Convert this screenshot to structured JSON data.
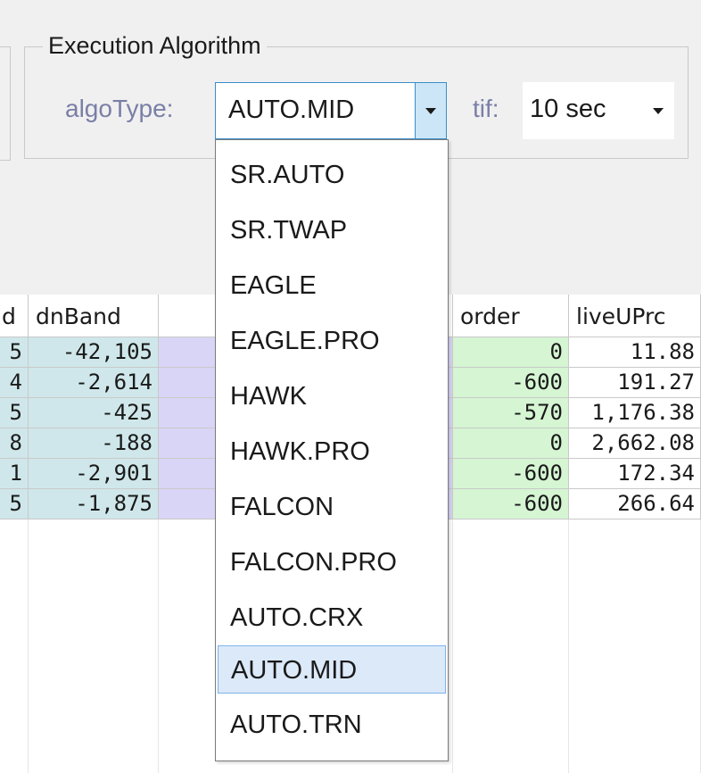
{
  "group": {
    "title": "Execution Algorithm",
    "algo_label": "algoType:",
    "algo_value": "AUTO.MID",
    "tif_label": "tif:",
    "tif_value": "10 sec"
  },
  "grid": {
    "headers": [
      "d",
      "dnBand",
      "",
      "order",
      "liveUPrc"
    ],
    "rows": [
      [
        "5",
        "-42,105",
        "",
        "0",
        "11.88"
      ],
      [
        "4",
        "-2,614",
        "",
        "-600",
        "191.27"
      ],
      [
        "5",
        "-425",
        "",
        "-570",
        "1,176.38"
      ],
      [
        "8",
        "-188",
        "",
        "0",
        "2,662.08"
      ],
      [
        "1",
        "-2,901",
        "",
        "-600",
        "172.34"
      ],
      [
        "5",
        "-1,875",
        "",
        "-600",
        "266.64"
      ]
    ]
  },
  "dropdown": {
    "options": [
      "SR.AUTO",
      "SR.TWAP",
      "EAGLE",
      "EAGLE.PRO",
      "HAWK",
      "HAWK.PRO",
      "FALCON",
      "FALCON.PRO",
      "AUTO.CRX",
      "AUTO.MID",
      "AUTO.TRN"
    ],
    "selected": "AUTO.MID"
  },
  "colors": {
    "teal": "#cfe7ea",
    "purple": "#d9d5f7",
    "green": "#d5f5d3",
    "accent": "#3c8ec9",
    "selection": "#dbe9f9"
  },
  "icons": {
    "combo_arrow": "chevron-down-icon"
  }
}
